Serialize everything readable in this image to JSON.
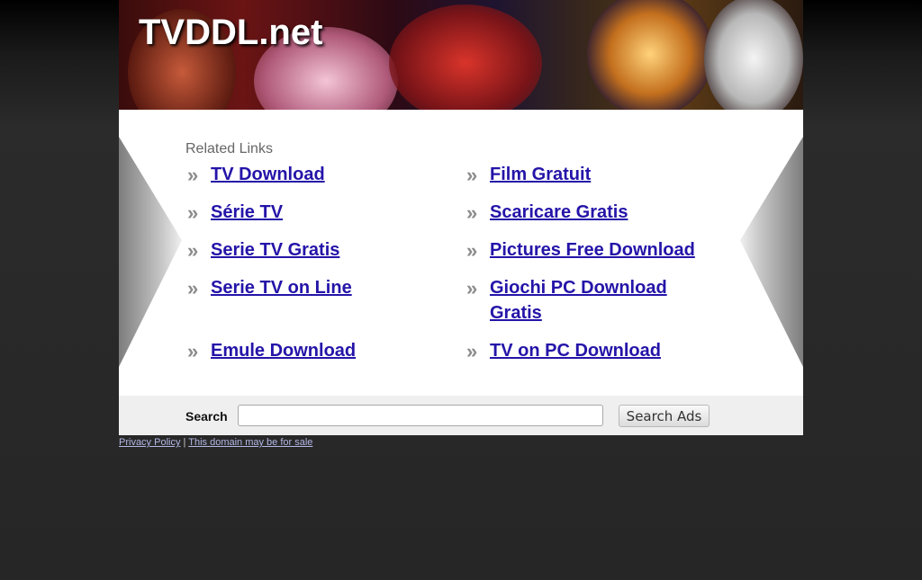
{
  "header": {
    "site_title": "TVDDL.net"
  },
  "related": {
    "heading": "Related Links",
    "left": [
      "TV Download",
      "Série TV",
      "Serie TV Gratis",
      "Serie TV on Line",
      "Emule Download"
    ],
    "right": [
      "Film Gratuit",
      "Scaricare Gratis",
      "Pictures Free Download",
      "Giochi PC Download Gratis",
      "TV on PC Download"
    ]
  },
  "search": {
    "label": "Search",
    "value": "",
    "button_label": "Search Ads"
  },
  "footer": {
    "privacy_label": "Privacy Policy",
    "separator": "|",
    "sale_label": "This domain may be for sale"
  },
  "colors": {
    "link": "#2414a8",
    "page_background": "#262626",
    "search_bar": "#efefef"
  }
}
